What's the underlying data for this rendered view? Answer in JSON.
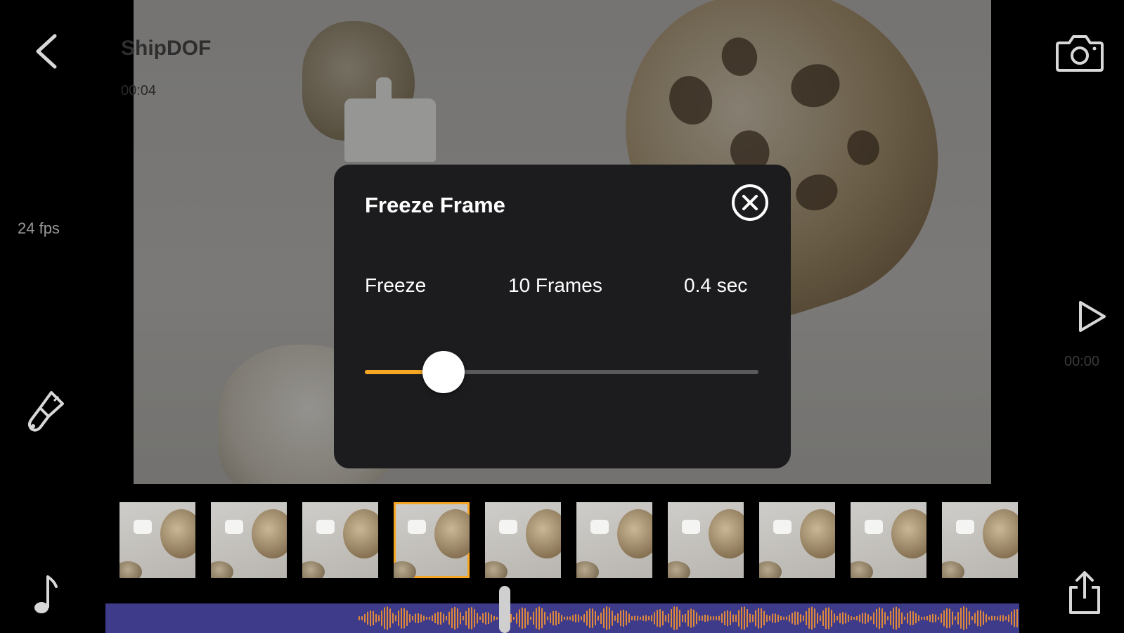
{
  "project": {
    "title": "ShipDOF",
    "duration": "00:04",
    "fps": "24 fps"
  },
  "player": {
    "time": "00:00"
  },
  "dialog": {
    "title": "Freeze Frame",
    "label": "Freeze",
    "frames": "10 Frames",
    "seconds": "0.4 sec",
    "slider_value_fraction": 0.2
  },
  "filmstrip": {
    "thumbnail_count": 10,
    "selected_index": 3
  },
  "colors": {
    "accent": "#f5a623",
    "audio_track": "#3d3b8a",
    "waveform": "#e0893a",
    "dialog_bg": "#1c1c1e"
  },
  "icons": {
    "back": "chevron-left-icon",
    "camera": "camera-icon",
    "play": "play-icon",
    "brush": "brush-icon",
    "music": "music-note-icon",
    "share": "share-icon",
    "close": "close-circle-icon"
  }
}
